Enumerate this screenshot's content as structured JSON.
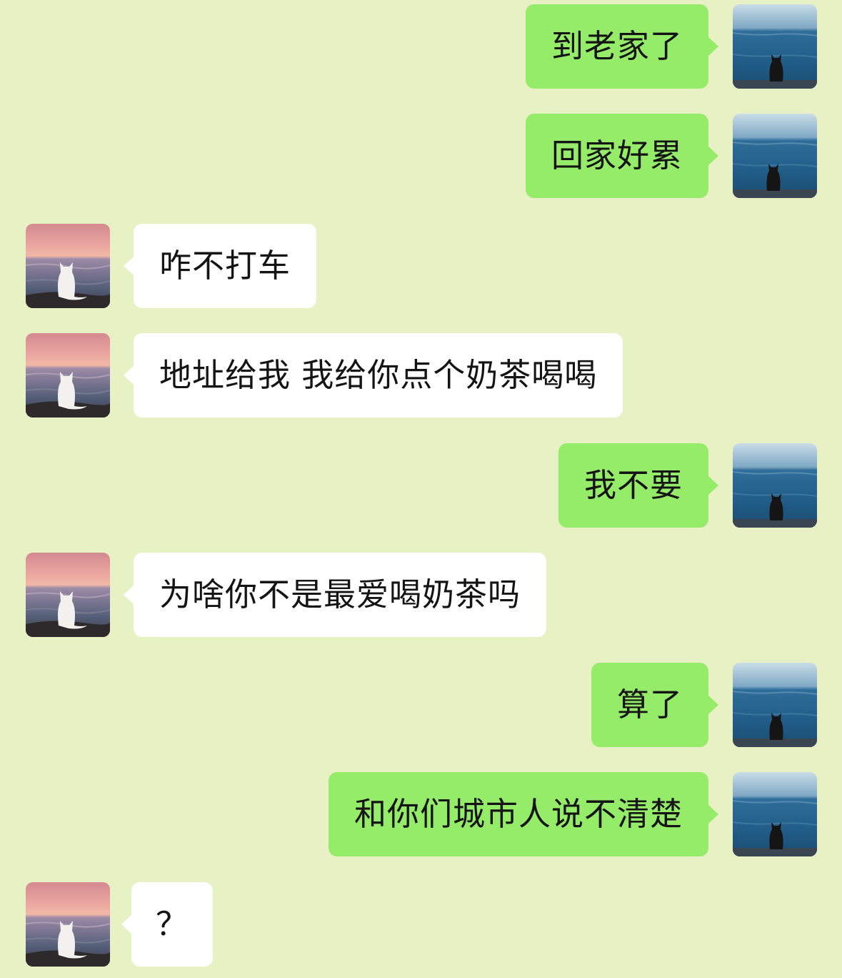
{
  "conversation": {
    "messages": [
      {
        "side": "sent",
        "text": "到老家了"
      },
      {
        "side": "sent",
        "text": "回家好累"
      },
      {
        "side": "recv",
        "text": "咋不打车"
      },
      {
        "side": "recv",
        "text": "地址给我 我给你点个奶茶喝喝"
      },
      {
        "side": "sent",
        "text": "我不要"
      },
      {
        "side": "recv",
        "text": "为啥你不是最爱喝奶茶吗"
      },
      {
        "side": "sent",
        "text": "算了"
      },
      {
        "side": "sent",
        "text": "和你们城市人说不清楚"
      },
      {
        "side": "recv",
        "text": "？"
      }
    ]
  },
  "colors": {
    "background": "#e8f1c3",
    "sent_bubble": "#95ec69",
    "received_bubble": "#ffffff"
  },
  "avatars": {
    "sent": "black-cat-sea-avatar",
    "received": "white-cat-sunset-avatar"
  }
}
